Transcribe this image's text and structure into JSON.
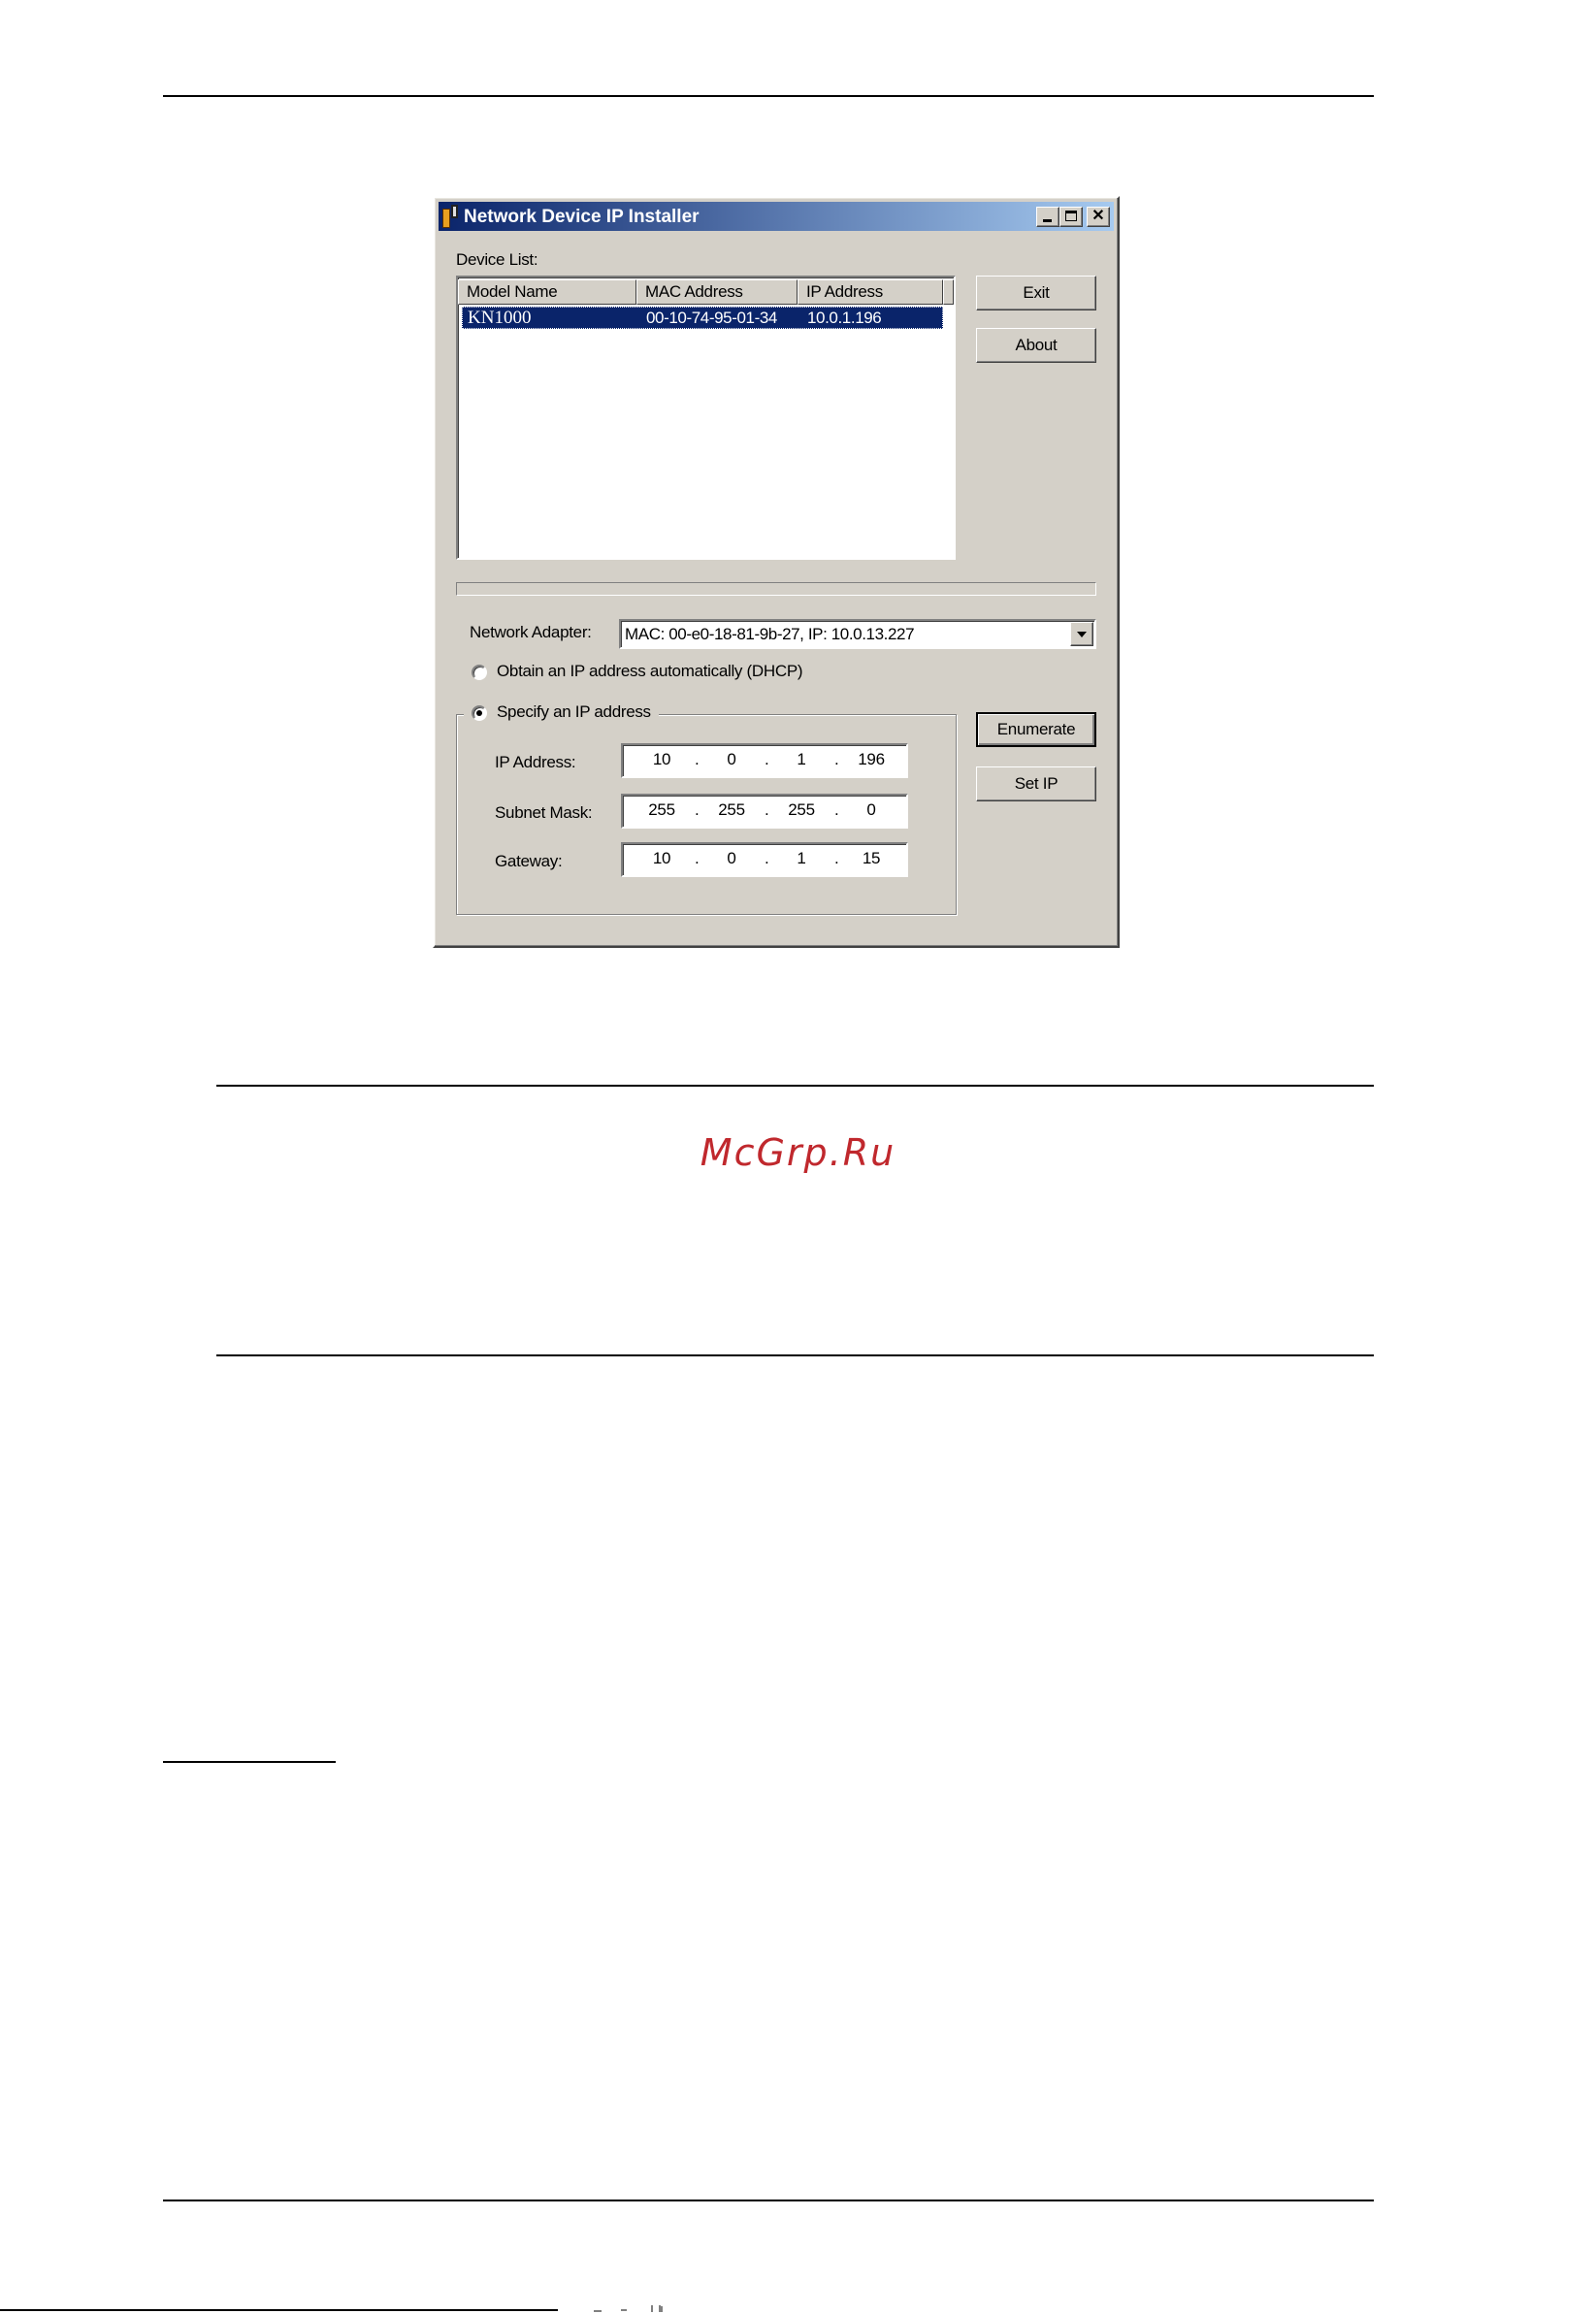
{
  "window": {
    "title": "Network Device IP Installer",
    "minimize_glyph": "_",
    "maximize_glyph": "□",
    "close_glyph": "✕"
  },
  "device_list": {
    "label": "Device List:",
    "columns": [
      "Model Name",
      "MAC Address",
      "IP Address"
    ],
    "rows": [
      {
        "model": "KN1000",
        "mac": "00-10-74-95-01-34",
        "ip": "10.0.1.196",
        "selected": true
      }
    ]
  },
  "buttons": {
    "exit": "Exit",
    "about": "About",
    "enumerate": "Enumerate",
    "set_ip": "Set IP"
  },
  "network_adapter": {
    "label": "Network Adapter:",
    "value": "MAC: 00-e0-18-81-9b-27,   IP: 10.0.13.227"
  },
  "ip_mode": {
    "dhcp_label": "Obtain an IP address automatically (DHCP)",
    "dhcp_checked": false,
    "static_label": "Specify an IP address",
    "static_checked": true
  },
  "static_ip": {
    "ip_label": "IP Address:",
    "ip": [
      "10",
      "0",
      "1",
      "196"
    ],
    "mask_label": "Subnet Mask:",
    "mask": [
      "255",
      "255",
      "255",
      "0"
    ],
    "gateway_label": "Gateway:",
    "gateway": [
      "10",
      "0",
      "1",
      "15"
    ]
  },
  "watermark": "McGrp.Ru",
  "colors": {
    "titlebar_start": "#0a246a",
    "titlebar_end": "#a6caf0",
    "selection": "#0a246a",
    "watermark": "#c0282d",
    "window_face": "#d4d0c8"
  }
}
